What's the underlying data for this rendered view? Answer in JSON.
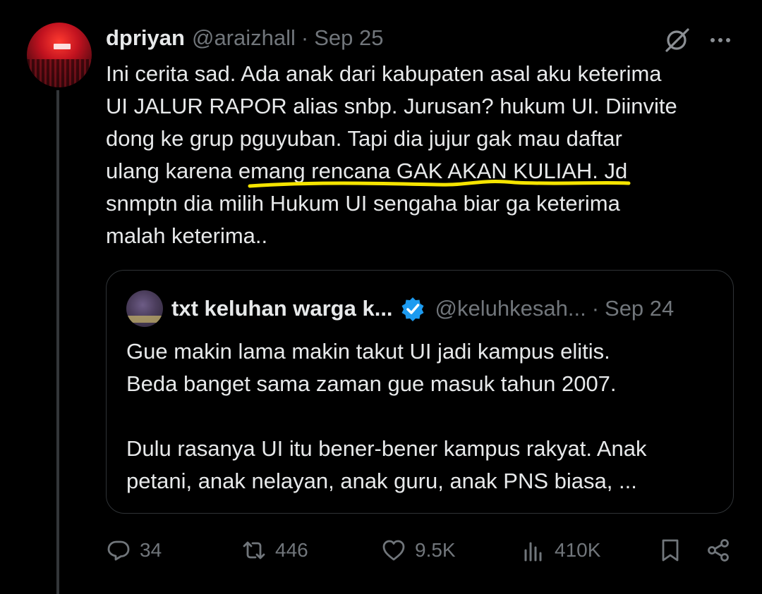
{
  "tweet": {
    "author_name": "dpriyan",
    "author_handle": "@araizhall",
    "separator": "·",
    "date": "Sep 25",
    "text_lines": [
      "Ini cerita sad. Ada anak dari kabupaten asal aku keterima",
      "UI JALUR RAPOR alias snbp. Jurusan? hukum UI. Diinvite",
      "dong ke grup pguyuban. Tapi dia jujur gak mau daftar",
      "ulang karena emang rencana GAK AKAN KULIAH. Jd",
      "snmptn dia milih Hukum UI sengaha biar ga keterima",
      "malah keterima.."
    ],
    "underline_color": "#f5e400"
  },
  "quote": {
    "author_name": "txt keluhan warga k...",
    "author_handle": "@keluhkesah...",
    "separator": "·",
    "date": "Sep 24",
    "verified_color": "#1d9bf0",
    "text_lines": [
      "Gue makin lama makin takut UI jadi kampus elitis.",
      "Beda banget sama zaman gue masuk tahun 2007.",
      "",
      "Dulu rasanya UI itu bener-bener kampus rakyat. Anak",
      "petani, anak nelayan, anak guru, anak PNS biasa, ..."
    ]
  },
  "actions": {
    "replies": "34",
    "reposts": "446",
    "likes": "9.5K",
    "views": "410K"
  },
  "icons": {
    "reply": "reply-icon",
    "repost": "repost-icon",
    "like": "heart-icon",
    "views": "views-icon",
    "bookmark": "bookmark-icon",
    "share": "share-icon",
    "grok": "grok-icon",
    "more": "more-icon",
    "verified": "verified-badge-icon"
  }
}
